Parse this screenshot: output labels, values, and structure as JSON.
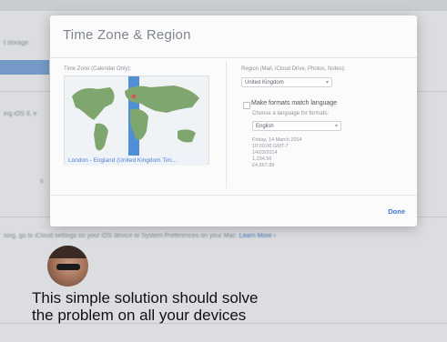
{
  "background": {
    "storage_label": "t storage.",
    "row2_label": "ing iOS 8, e",
    "row3_label": "s",
    "footer_text": "sing, go to iCloud settings on your iOS device or System Preferences on your Mac.",
    "footer_link": "Learn More ›"
  },
  "dialog": {
    "title": "Time Zone & Region",
    "timezone_label": "Time Zone (Calendar Only):",
    "timezone_value": "London - England (United Kingdom Tim...",
    "region_label": "Region (Mail, iCloud Drive, Photos, Notes):",
    "region_value": "United Kingdom",
    "match_label": "Make formats match language",
    "match_checked": false,
    "language_label": "Choose a language for formats:",
    "language_value": "English",
    "format_examples": [
      "Friday, 14 March 2014",
      "10:00:00 GMT-7",
      "14/03/2014",
      "1,234.56",
      "£4,567.89"
    ],
    "done_label": "Done"
  },
  "caption": {
    "line1": "This simple solution should solve",
    "line2": "the problem on all your devices"
  }
}
